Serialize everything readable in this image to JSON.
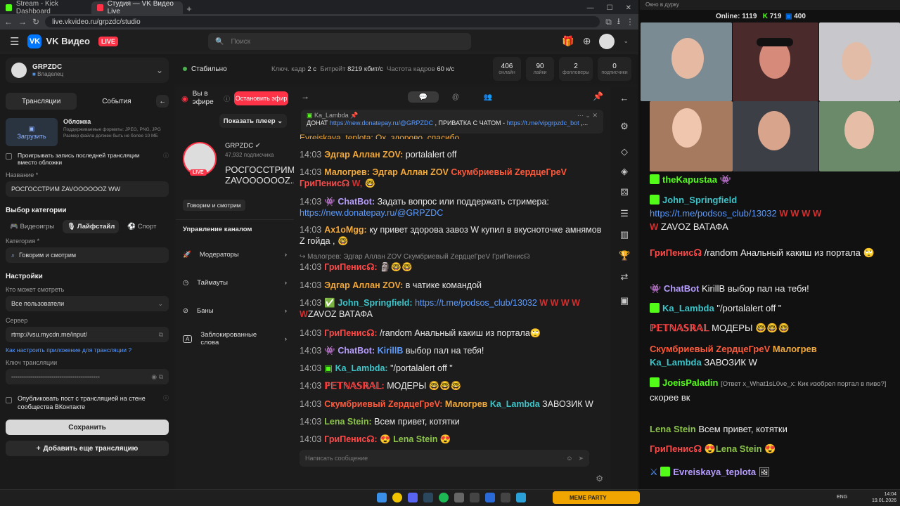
{
  "browser": {
    "tabs": [
      {
        "title": "Stream - Kick Dashboard",
        "color": "#53fc18"
      },
      {
        "title": "Студия — VK Видео Live",
        "color": "#ff3347"
      }
    ],
    "url": "live.vkvideo.ru/grpzdc/studio"
  },
  "vk": {
    "brand": "VK Видео",
    "live_badge": "LIVE",
    "search_placeholder": "Поиск"
  },
  "channel": {
    "name": "GRPZDC",
    "role": "Владелец"
  },
  "status": {
    "state": "Стабильно",
    "keyframe_label": "Ключ. кадр",
    "keyframe_value": "2 с",
    "bitrate_label": "Битрейт",
    "bitrate_value": "8219 кбит/с",
    "fps_label": "Частота кадров",
    "fps_value": "60 к/с"
  },
  "stats": [
    {
      "value": "406",
      "label": "онлайн"
    },
    {
      "value": "90",
      "label": "лайки"
    },
    {
      "value": "2",
      "label": "фолловеры"
    },
    {
      "value": "0",
      "label": "подписчики"
    }
  ],
  "left": {
    "tabs": [
      "Трансляции",
      "События"
    ],
    "cover_title": "Обложка",
    "cover_desc": "Поддерживаемые форматы: JPEG, PNG, JPG Размер файла должен быть не более 10 МБ",
    "upload": "Загрузить",
    "replay_check": "Проигрывать запись последней трансляции вместо обложки",
    "title_label": "Название *",
    "title_value": "РОСГОССТРИМ ZAVOOOOOOZ WW",
    "category_section": "Выбор категории",
    "cat_tabs": [
      "Видеоигры",
      "Лайфстайл",
      "Спорт"
    ],
    "category_label": "Категория *",
    "category_value": "Говорим и смотрим",
    "settings": "Настройки",
    "who_label": "Кто может смотреть",
    "who_value": "Все пользователи",
    "server_label": "Сервер",
    "server_value": "rtmp://vsu.mycdn.me/input/",
    "howto_link": "Как настроить приложение для трансляции",
    "key_label": "Ключ трансляции",
    "key_value": "------------------------------------------",
    "publish_check": "Опубликовать пост с трансляцией на стене сообщества ВКонтакте",
    "save": "Сохранить",
    "add_stream": "Добавить еще трансляцию"
  },
  "mid": {
    "on_air": "Вы в эфире",
    "stop": "Остановить эфир",
    "show_player": "Показать плеер",
    "channel": "GRPZDC",
    "subs": "47,932 подписчика",
    "stream_title": "РОСГОССТРИМ ZAVOOOOOOZ...",
    "live": "LIVE",
    "tag": "Говорим и смотрим",
    "manage": "Управление каналом",
    "items": [
      "Модераторы",
      "Таймауты",
      "Баны",
      "Заблокированные слова"
    ]
  },
  "chat": {
    "pinned_author": "Ka_Lambda",
    "pinned_prefix": "ДОНАТ",
    "pinned_link1": "https://new.donatepay.ru/@GRPZDC",
    "pinned_mid": ", ПРИВАТКА С ЧАТОМ -",
    "pinned_link2": "https://t.me/vipgrpzdc_bot",
    "pinned_tail": ",...",
    "partial_top": "Evreiskaya_teplota: Ох, здорово, спасибо",
    "input_placeholder": "Написать сообщение",
    "reply_ref": "Малогрев: Эдгар Аллан ZOV Скумбриевый ZердцеГреV ГриПенис☊",
    "messages": [
      {
        "time": "14:03",
        "user": "Эдгар Аллан ZOV:",
        "ucolor": "#f2a93b",
        "text": "portalalert off"
      },
      {
        "time": "14:03",
        "user": "Малогрев:",
        "ucolor": "#f2a93b",
        "text": "Эдгар Аллан ZOV",
        "text2": "Скумбриевый ZердцеГреV",
        "text3": "ГриПенис☊",
        "tail": "W,"
      },
      {
        "time": "14:03",
        "user": "ChatBot:",
        "ucolor": "#b69cff",
        "text": "Задать вопрос или поддержать стримера:",
        "link": "https://new.donatepay.ru/@GRPZDC"
      },
      {
        "time": "14:03",
        "user": "Ax1oMgg:",
        "ucolor": "#f2a93b",
        "text": "ку привет здорова завоз W купил в вкусноточке амнямов Z гойда ,"
      },
      {
        "time": "14:03",
        "user": "ГриПенис☊:",
        "ucolor": "#ff4a4a",
        "text": ""
      },
      {
        "time": "14:03",
        "user": "Эдгар Аллан ZOV:",
        "ucolor": "#f2a93b",
        "text": "в чатике командой"
      },
      {
        "time": "14:03",
        "user": "John_Springfield:",
        "ucolor": "#3ec3c8",
        "link": "https://t.me/podsos_club/13032",
        "text": "W W W W",
        "text2": "W",
        "text3": "ZAVOZ ВАТАФА"
      },
      {
        "time": "14:03",
        "user": "ГриПенис☊:",
        "ucolor": "#ff4a4a",
        "text": "/random Анальный какиш из портала"
      },
      {
        "time": "14:03",
        "user": "ChatBot:",
        "ucolor": "#b69cff",
        "text": "выбор пал на тебя!",
        "mention": "KirillB"
      },
      {
        "time": "14:03",
        "user": "Ka_Lambda:",
        "ucolor": "#3ec3c8",
        "text": "\"/portalalert off \""
      },
      {
        "time": "14:03",
        "user": "ℙ𝔼𝕋ℕ𝔸𝕊ℝ𝔸𝕃:",
        "ucolor": "#ff4a4a",
        "text": "МОДЕРЫ"
      },
      {
        "time": "14:03",
        "user": "Скумбриевый ZердцеГреV:",
        "ucolor": "#ff5a3c",
        "text": "ЗАВОЗИК W",
        "m1": "Малогрев",
        "m2": "Ka_Lambda"
      },
      {
        "time": "14:03",
        "user": "Lena Stein:",
        "ucolor": "#8bc34a",
        "text": "Всем привет, котятки"
      },
      {
        "time": "14:03",
        "user": "ГриПенис☊:",
        "ucolor": "#ff4a4a",
        "text": "Lena Stein"
      }
    ]
  },
  "stream": {
    "window_title": "Окно в дурку",
    "online_label": "Online:",
    "online_value": "1119",
    "kick_count": "719",
    "vk_count": "400",
    "chat": [
      {
        "user": "theKapustaa",
        "ucolor": "#53fc18",
        "text": ""
      },
      {
        "user": "John_Springfield",
        "ucolor": "#3ec3c8",
        "link": "https://t.me/podsos_club/13032",
        "text": "W W W W",
        "text2": "W",
        "text3": "ZAVOZ ВАТАФА"
      },
      {
        "user": "ГриПенис☊",
        "ucolor": "#ff4a4a",
        "text": "/random Анальный какиш из портала"
      },
      {
        "user": "ChatBot",
        "ucolor": "#b69cff",
        "text": "KirillB выбор пал на тебя!"
      },
      {
        "user": "Ka_Lambda",
        "ucolor": "#3ec3c8",
        "text": "\"/portalalert off \""
      },
      {
        "user": "ℙ𝔼𝕋ℕ𝔸𝕊ℝ𝔸𝕃",
        "ucolor": "#ff4a4a",
        "text": "МОДЕРЫ"
      },
      {
        "user": "Скумбриевый ZердцеГреV",
        "ucolor": "#ff5a3c",
        "text": "Малогрев",
        "text2": "Ka_Lambda",
        "text3": "ЗАВОЗИК W"
      },
      {
        "user": "JoeisPaladin",
        "ucolor": "#53fc18",
        "text": "[Ответ x_What1sL0ve_x: Кик изобрел портал в пиво?]",
        "text2": "скорее вк"
      },
      {
        "user": "Lena Stein",
        "ucolor": "#8bc34a",
        "text": "Всем привет, котятки"
      },
      {
        "user": "ГриПенис☊",
        "ucolor": "#ff4a4a",
        "text": "Lena Stein"
      },
      {
        "user": "Evreiskaya_teplota",
        "ucolor": "#b69cff",
        "text": ""
      }
    ]
  },
  "taskbar": {
    "lang": "ENG",
    "time": "14:04",
    "date": "19.01.2026",
    "widget": "MEME PARTY"
  }
}
